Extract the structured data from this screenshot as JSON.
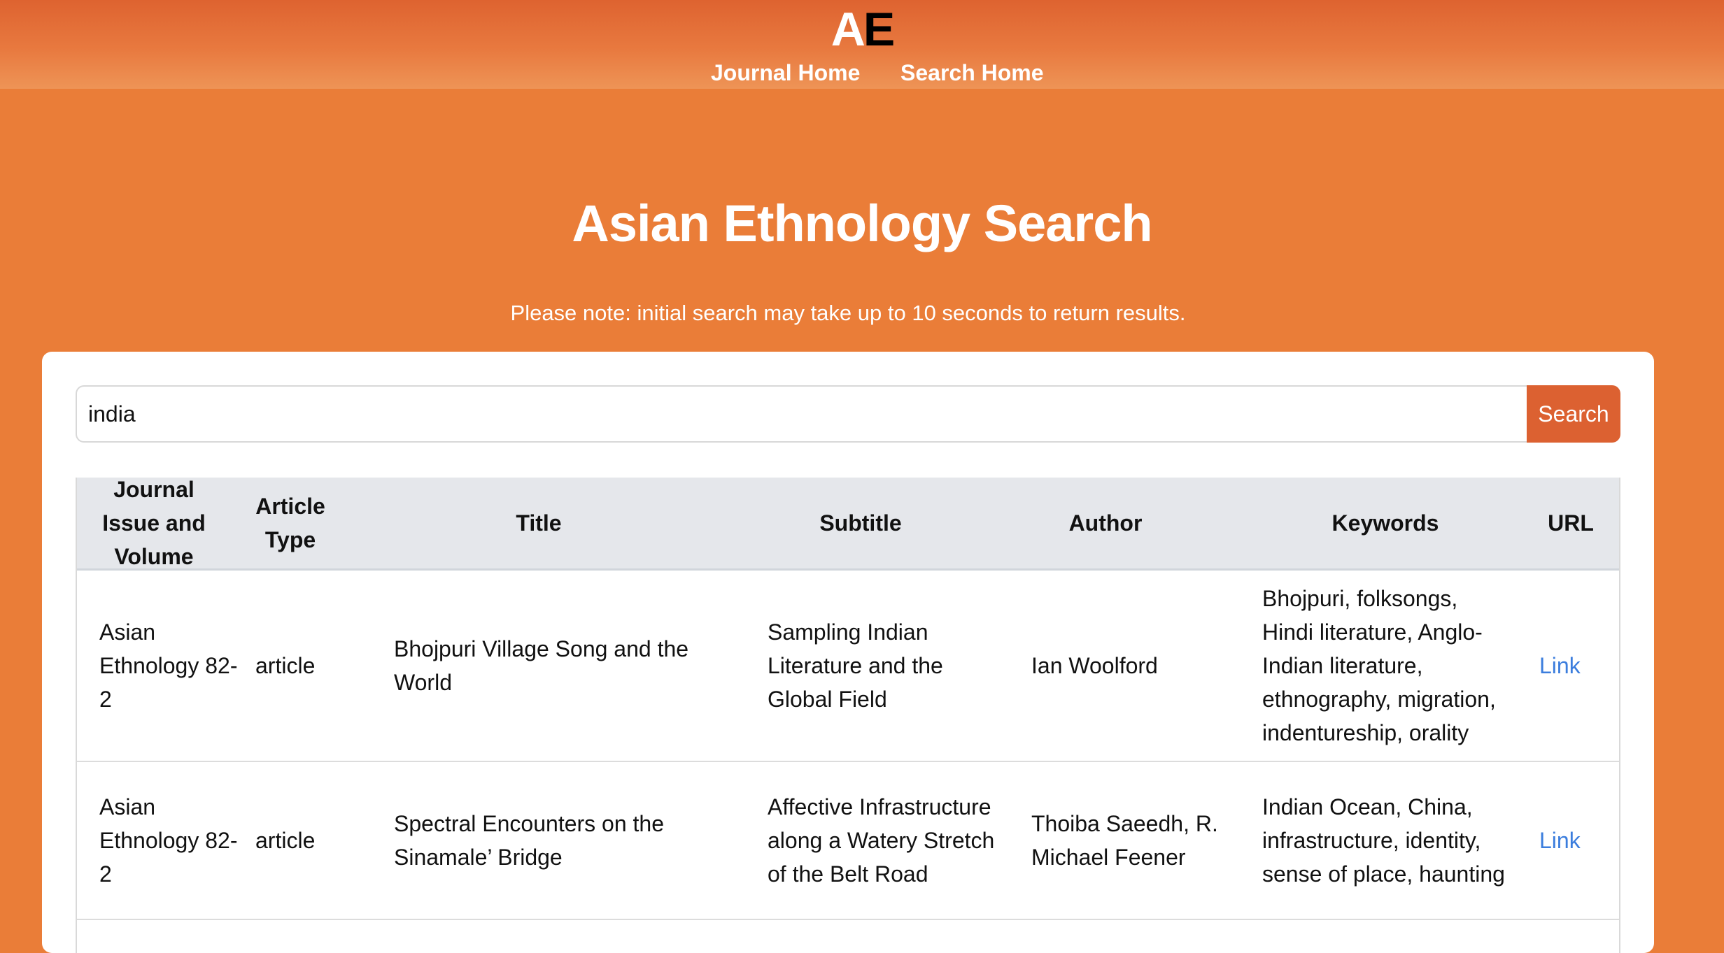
{
  "header": {
    "logo_a": "A",
    "logo_e": "E",
    "nav": [
      {
        "label": "Journal Home"
      },
      {
        "label": "Search Home"
      }
    ]
  },
  "page": {
    "title": "Asian Ethnology Search",
    "note": "Please note: initial search may take up to 10 seconds to return results."
  },
  "search": {
    "value": "india",
    "button_label": "Search"
  },
  "table": {
    "columns": [
      "Journal Issue and Volume",
      "Article Type",
      "Title",
      "Subtitle",
      "Author",
      "Keywords",
      "URL"
    ],
    "rows": [
      {
        "issue": "Asian Ethnology 82-2",
        "type": "article",
        "title": "Bhojpuri Village Song and the World",
        "subtitle": "Sampling Indian Literature and the Global Field",
        "author": "Ian Woolford",
        "keywords": "Bhojpuri, folksongs, Hindi literature, Anglo-Indian literature, ethnography, migration, indentureship, orality",
        "url": "Link"
      },
      {
        "issue": "Asian Ethnology 82-2",
        "type": "article",
        "title": "Spectral Encounters on the Sinamale’ Bridge",
        "subtitle": "Affective Infrastructure along a Watery Stretch of the Belt Road",
        "author": "Thoiba Saeedh, R. Michael Feener",
        "keywords": "Indian Ocean, China, infrastructure, identity, sense of place, haunting",
        "url": "Link"
      }
    ]
  },
  "colors": {
    "page_background": "#ea7d38",
    "search_button": "#dc6131",
    "link": "#3b7ddd",
    "table_header": "#e5e7eb"
  }
}
